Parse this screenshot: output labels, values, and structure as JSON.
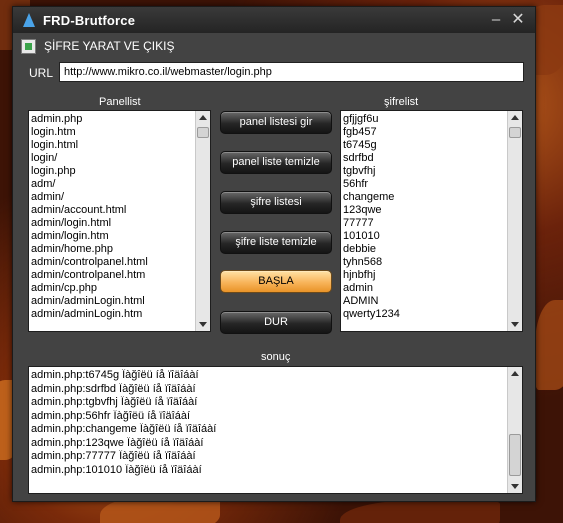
{
  "window": {
    "title": "FRD-Brutforce"
  },
  "menu": {
    "label": "ŞİFRE YARAT VE ÇIKIŞ"
  },
  "url": {
    "label": "URL",
    "value": "http://www.mikro.co.il/webmaster/login.php"
  },
  "panellist": {
    "label": "Panellist",
    "items": [
      "admin.php",
      "login.htm",
      "login.html",
      "login/",
      "login.php",
      "adm/",
      "admin/",
      "admin/account.html",
      "admin/login.html",
      "admin/login.htm",
      "admin/home.php",
      "admin/controlpanel.html",
      "admin/controlpanel.htm",
      "admin/cp.php",
      "admin/adminLogin.html",
      "admin/adminLogin.htm"
    ]
  },
  "sifrelist": {
    "label": "şifrelist",
    "items": [
      "gfjjgf6u",
      "fgb457",
      "t6745g",
      "sdrfbd",
      "tgbvfhj",
      "56hfr",
      "changeme",
      "123qwe",
      "77777",
      "101010",
      "debbie",
      "tyhn568",
      "hjnbfhj",
      "admin",
      "ADMIN",
      "qwerty1234"
    ]
  },
  "buttons": {
    "panel_listesi_gir": "panel listesi gir",
    "panel_liste_temizle": "panel liste temizle",
    "sifre_listesi": "şifre listesi",
    "sifre_liste_temizle": "şifre liste temizle",
    "basla": "BAŞLA",
    "dur": "DUR"
  },
  "results": {
    "label": "sonuç",
    "items": [
      "admin.php:t6745g Ïàğîëü íå ïîäîáàí",
      "admin.php:sdrfbd Ïàğîëü íå ïîäîáàí",
      "admin.php:tgbvfhj Ïàğîëü íå ïîäîáàí",
      "admin.php:56hfr Ïàğîëü íå ïîäîáàí",
      "admin.php:changeme Ïàğîëü íå ïîäîáàí",
      "admin.php:123qwe Ïàğîëü íå ïîäîáàí",
      "admin.php:77777 Ïàğîëü íå ïîäîáàí",
      "admin.php:101010 Ïàğîëü íå ïîäîáàí"
    ]
  },
  "colors": {
    "accent": "#f8b45a",
    "window_bg": "#434343"
  }
}
